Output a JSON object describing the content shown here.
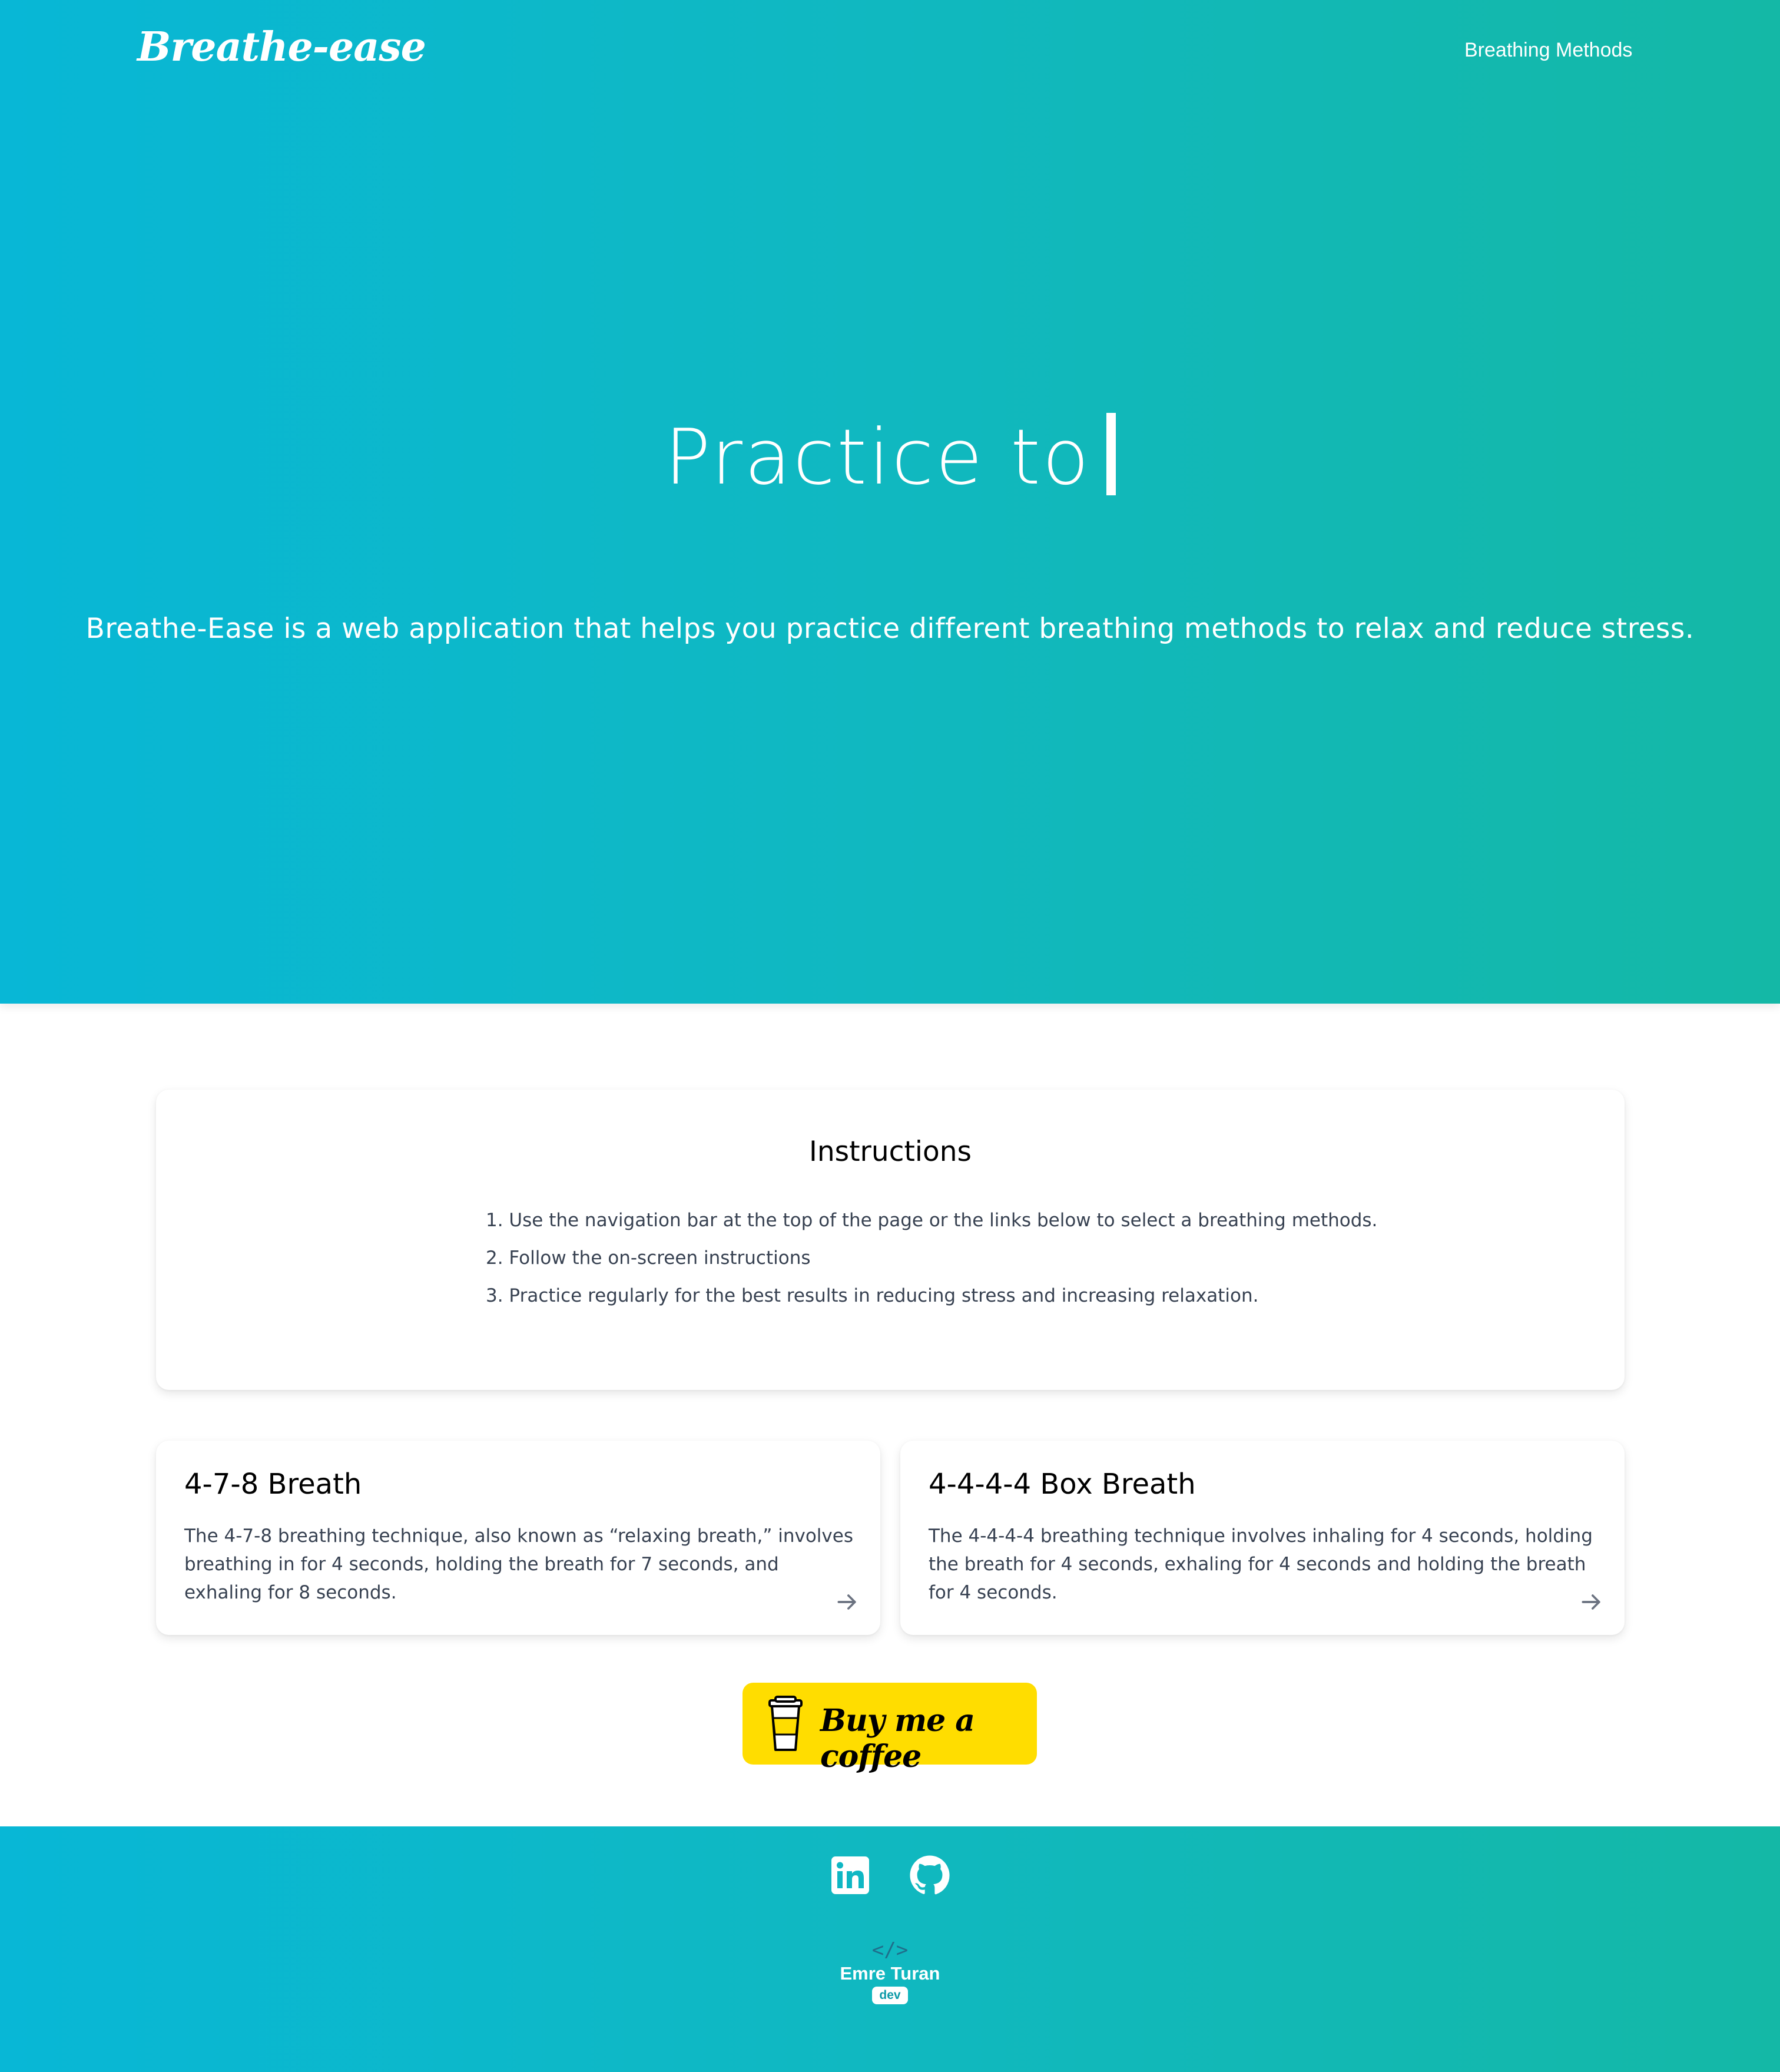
{
  "header": {
    "brand": "Breathe-ease",
    "nav_link": "Breathing Methods"
  },
  "hero": {
    "title": "Practice to",
    "subtitle": "Breathe-Ease is a web application that helps you practice different breathing methods to relax and reduce stress."
  },
  "instructions": {
    "title": "Instructions",
    "items": [
      "1. Use the navigation bar at the top of the page or the links below to select a breathing methods.",
      "2. Follow the on-screen instructions",
      "3. Practice regularly for the best results in reducing stress and increasing relaxation."
    ]
  },
  "methods": [
    {
      "title": "4-7-8 Breath",
      "description": "The 4-7-8 breathing technique, also known as “relaxing breath,” involves breathing in for 4 seconds, holding the breath for 7 seconds, and exhaling for 8 seconds.",
      "icon": "arrow-right-icon"
    },
    {
      "title": "4-4-4-4 Box Breath",
      "description": "The 4-4-4-4 breathing technique involves inhaling for 4 seconds, holding the breath for 4 seconds, exhaling for 4 seconds and holding the breath for 4 seconds.",
      "icon": "arrow-right-icon"
    }
  ],
  "coffee": {
    "label": "Buy me a coffee",
    "icon": "coffee-cup-icon",
    "color": "#ffdd00"
  },
  "footer": {
    "social": [
      "linkedin-icon",
      "github-icon"
    ],
    "dev_code": "</>",
    "dev_name": "Emre Turan",
    "dev_badge": "dev"
  },
  "colors": {
    "gradient_start": "#08b7d6",
    "gradient_end": "#14b8a6",
    "body_text": "#374151"
  }
}
